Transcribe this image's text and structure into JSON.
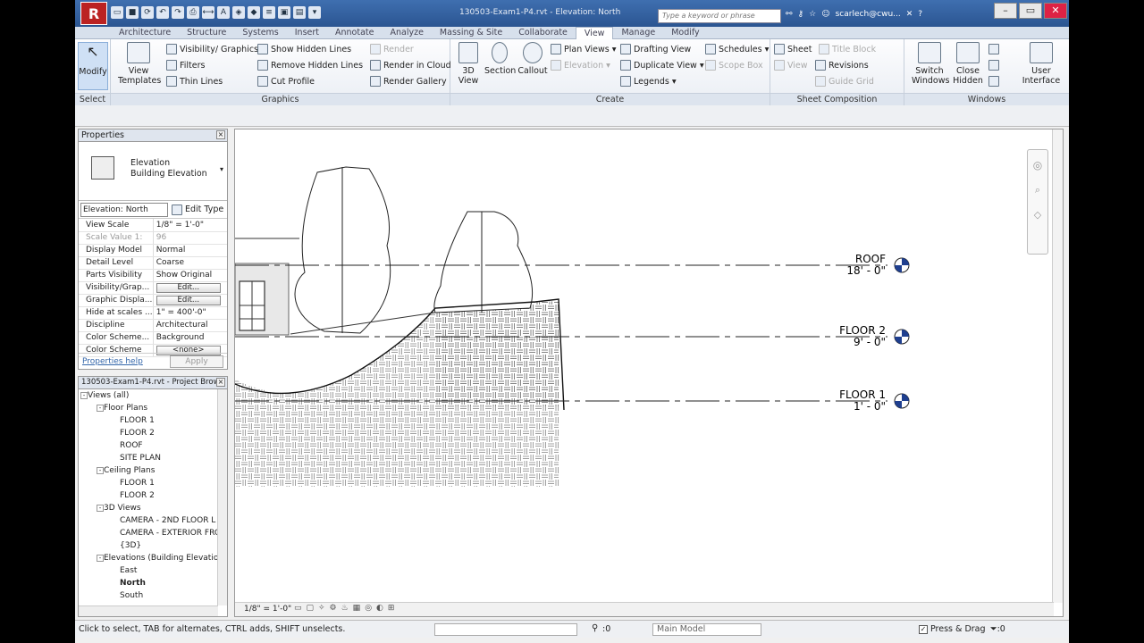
{
  "titlebar": {
    "doc_title": "130503-Exam1-P4.rvt - Elevation: North",
    "search_placeholder": "Type a keyword or phrase",
    "user": "scarlech@cwu...",
    "logo": "R"
  },
  "tabs": [
    "Architecture",
    "Structure",
    "Systems",
    "Insert",
    "Annotate",
    "Analyze",
    "Massing & Site",
    "Collaborate",
    "View",
    "Manage",
    "Modify"
  ],
  "active_tab": "View",
  "ribbon": {
    "select": {
      "modify": "Modify",
      "title": "Select"
    },
    "graphics": {
      "title": "Graphics",
      "view_templates": "View\nTemplates",
      "vis_graphics": "Visibility/ Graphics",
      "filters": "Filters",
      "thin_lines": "Thin Lines",
      "show_hidden": "Show Hidden Lines",
      "remove_hidden": "Remove Hidden Lines",
      "cut_profile": "Cut Profile",
      "render": "Render",
      "render_cloud": "Render in Cloud",
      "render_gallery": "Render Gallery"
    },
    "create": {
      "title": "Create",
      "view3d": "3D\nView",
      "section": "Section",
      "callout": "Callout",
      "plan_views": "Plan Views",
      "elevation": "Elevation",
      "drafting": "Drafting View",
      "duplicate": "Duplicate View",
      "legends": "Legends",
      "schedules": "Schedules",
      "scope_box": "Scope Box"
    },
    "sheet": {
      "title": "Sheet Composition",
      "sheet": "Sheet",
      "title_block": "Title Block",
      "view": "View",
      "revisions": "Revisions",
      "guide_grid": "Guide Grid"
    },
    "windows": {
      "title": "Windows",
      "switch": "Switch\nWindows",
      "close_hidden": "Close\nHidden",
      "ui": "User\nInterface"
    }
  },
  "properties": {
    "title": "Properties",
    "type_name": "Elevation",
    "type_sub": "Building Elevation",
    "instance": "Elevation: North",
    "edit_type": "Edit Type",
    "rows": [
      [
        "View Scale",
        "1/8\" = 1'-0\"",
        ""
      ],
      [
        "Scale Value   1:",
        "96",
        "dim"
      ],
      [
        "Display Model",
        "Normal",
        ""
      ],
      [
        "Detail Level",
        "Coarse",
        ""
      ],
      [
        "Parts Visibility",
        "Show Original",
        ""
      ],
      [
        "Visibility/Grap...",
        "Edit...",
        "btn"
      ],
      [
        "Graphic Displa...",
        "Edit...",
        "btn"
      ],
      [
        "Hide at scales ...",
        "1\" = 400'-0\"",
        ""
      ],
      [
        "Discipline",
        "Architectural",
        ""
      ],
      [
        "Color Scheme...",
        "Background",
        ""
      ],
      [
        "Color Scheme",
        "<none>",
        "btn"
      ]
    ],
    "help": "Properties help",
    "apply": "Apply"
  },
  "browser": {
    "title": "130503-Exam1-P4.rvt - Project Brow...",
    "nodes": [
      {
        "label": "Views (all)",
        "level": 0,
        "exp": "-"
      },
      {
        "label": "Floor Plans",
        "level": 1,
        "exp": "-"
      },
      {
        "label": "FLOOR 1",
        "level": 2
      },
      {
        "label": "FLOOR 2",
        "level": 2
      },
      {
        "label": "ROOF",
        "level": 2
      },
      {
        "label": "SITE PLAN",
        "level": 2
      },
      {
        "label": "Ceiling Plans",
        "level": 1,
        "exp": "-"
      },
      {
        "label": "FLOOR 1",
        "level": 2
      },
      {
        "label": "FLOOR 2",
        "level": 2
      },
      {
        "label": "3D Views",
        "level": 1,
        "exp": "-"
      },
      {
        "label": "CAMERA - 2ND FLOOR L",
        "level": 2
      },
      {
        "label": "CAMERA - EXTERIOR FRC",
        "level": 2
      },
      {
        "label": "{3D}",
        "level": 2
      },
      {
        "label": "Elevations (Building Elevation",
        "level": 1,
        "exp": "-"
      },
      {
        "label": "East",
        "level": 2
      },
      {
        "label": "North",
        "level": 2,
        "bold": true
      },
      {
        "label": "South",
        "level": 2
      }
    ]
  },
  "levels": [
    {
      "name": "ROOF",
      "elev": "18' - 0\""
    },
    {
      "name": "FLOOR 2",
      "elev": "9' - 0\""
    },
    {
      "name": "FLOOR 1",
      "elev": "1' - 0\""
    }
  ],
  "view_scale": "1/8\" = 1'-0\"",
  "status": {
    "message": "Click to select, TAB for alternates, CTRL adds, SHIFT unselects.",
    "filter_count": ":0",
    "sel_count": ":0",
    "model": "Main Model",
    "press_drag": "Press & Drag"
  },
  "colors": {
    "title_bar": "#2b5591",
    "level_head": "#1f3f8f",
    "tab_bg": "#d7e0ec"
  }
}
